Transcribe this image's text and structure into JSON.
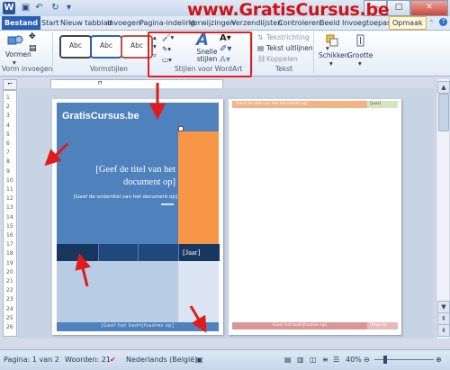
{
  "watermark": "www.GratisCursus.be",
  "tabs": [
    {
      "label": "Bestand"
    },
    {
      "label": "Start"
    },
    {
      "label": "Nieuw tabblad"
    },
    {
      "label": "Invoegen"
    },
    {
      "label": "Pagina-indeling"
    },
    {
      "label": "Verwijzingen"
    },
    {
      "label": "Verzendlijsten"
    },
    {
      "label": "Controleren"
    },
    {
      "label": "Beeld"
    },
    {
      "label": "Invoegtoepass"
    },
    {
      "label": "Opmaak"
    }
  ],
  "ribbon": {
    "vormen_label": "Vormen",
    "vorm_invoegen_label": "Vorm invoegen",
    "vormstijlen_label": "Vormstijlen",
    "style_samples": [
      "Abc",
      "Abc",
      "Abc"
    ],
    "snelle_stijlen_label": "Snelle stijlen",
    "wordart_label": "Stijlen voor WordArt",
    "tekstrichting_label": "Tekstrichting",
    "tekst_uitlijnen_label": "Tekst uitlijnen",
    "koppelen_label": "Koppelen",
    "tekst_label": "Tekst",
    "schikken_label": "Schikken",
    "grootte_label": "Grootte"
  },
  "page1": {
    "header_title": "GratisCursus.be",
    "title_placeholder": "[Geef de titel van het document op]",
    "subtitle_placeholder": "[Geef de ondertitel van het document op]",
    "year_placeholder": "[Jaar]",
    "footer_text": "[Geef het bedrijfsadres op]"
  },
  "page2": {
    "header_text": "[Geef de titel van het document op]",
    "header_year": "[Jaar]",
    "footer_text": "[Geef het bedrijfsadres op]",
    "footer_page": "[Pagina]"
  },
  "ruler_numbers": [
    "1",
    "2",
    "3",
    "4",
    "5",
    "6",
    "7",
    "8",
    "9",
    "10",
    "11",
    "12",
    "13",
    "14",
    "15",
    "16",
    "17",
    "18",
    "19",
    "20",
    "21",
    "22",
    "23",
    "24",
    "25",
    "26"
  ],
  "statusbar": {
    "page": "Pagina: 1 van 2",
    "words": "Woorden: 21",
    "language": "Nederlands (België)",
    "zoom": "40%"
  },
  "colors": {
    "accent_blue": "#4f81bd",
    "dark_blue": "#17375e",
    "orange": "#f79646",
    "light_blue": "#b8cce4",
    "annotation_red": "#e01b1b"
  }
}
